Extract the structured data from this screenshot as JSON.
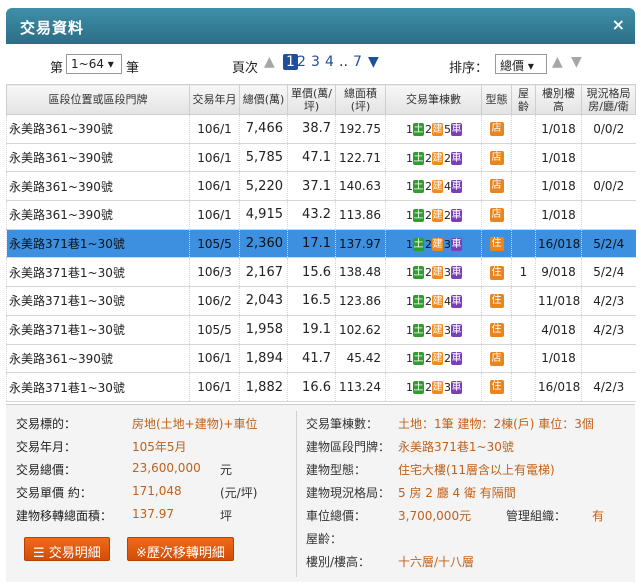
{
  "window": {
    "title": "交易資料",
    "close_icon": "×"
  },
  "toolbar": {
    "select_prefix": "第",
    "range_value": "1~64",
    "select_suffix": "筆",
    "page_label": "頁次",
    "pages": [
      "1",
      "2",
      "3",
      "4",
      "..",
      "7"
    ],
    "sort_label": "排序：",
    "sort_value": "總價"
  },
  "columns": [
    "區段位置或區段門牌",
    "交易年月",
    "總價(萬)",
    "單價(萬/坪)",
    "總面積(坪)",
    "交易筆棟數",
    "型態",
    "屋齡",
    "樓別樓高",
    "現況格局房/廳/衛"
  ],
  "rows": [
    {
      "addr": "永美路361~390號",
      "ym": "106/1",
      "total": "7,466",
      "unit": "38.7",
      "area": "192.75",
      "land": "1",
      "bld": "2",
      "car": "5",
      "type": "店",
      "age": "",
      "floor": "1/018",
      "layout": "0/0/2",
      "hl": false
    },
    {
      "addr": "永美路361~390號",
      "ym": "106/1",
      "total": "5,785",
      "unit": "47.1",
      "area": "122.71",
      "land": "1",
      "bld": "2",
      "car": "2",
      "type": "店",
      "age": "",
      "floor": "1/018",
      "layout": "",
      "hl": false
    },
    {
      "addr": "永美路361~390號",
      "ym": "106/1",
      "total": "5,220",
      "unit": "37.1",
      "area": "140.63",
      "land": "1",
      "bld": "2",
      "car": "4",
      "type": "店",
      "age": "",
      "floor": "1/018",
      "layout": "0/0/2",
      "hl": false
    },
    {
      "addr": "永美路361~390號",
      "ym": "106/1",
      "total": "4,915",
      "unit": "43.2",
      "area": "113.86",
      "land": "1",
      "bld": "2",
      "car": "2",
      "type": "店",
      "age": "",
      "floor": "1/018",
      "layout": "",
      "hl": false
    },
    {
      "addr": "永美路371巷1~30號",
      "ym": "105/5",
      "total": "2,360",
      "unit": "17.1",
      "area": "137.97",
      "land": "1",
      "bld": "2",
      "car": "3",
      "type": "住",
      "age": "",
      "floor": "16/018",
      "layout": "5/2/4",
      "hl": true
    },
    {
      "addr": "永美路371巷1~30號",
      "ym": "106/3",
      "total": "2,167",
      "unit": "15.6",
      "area": "138.48",
      "land": "1",
      "bld": "2",
      "car": "3",
      "type": "住",
      "age": "1",
      "floor": "9/018",
      "layout": "5/2/4",
      "hl": false
    },
    {
      "addr": "永美路371巷1~30號",
      "ym": "106/2",
      "total": "2,043",
      "unit": "16.5",
      "area": "123.86",
      "land": "1",
      "bld": "2",
      "car": "4",
      "type": "住",
      "age": "",
      "floor": "11/018",
      "layout": "4/2/3",
      "hl": false
    },
    {
      "addr": "永美路371巷1~30號",
      "ym": "105/5",
      "total": "1,958",
      "unit": "19.1",
      "area": "102.62",
      "land": "1",
      "bld": "2",
      "car": "3",
      "type": "住",
      "age": "",
      "floor": "4/018",
      "layout": "4/2/3",
      "hl": false
    },
    {
      "addr": "永美路361~390號",
      "ym": "106/1",
      "total": "1,894",
      "unit": "41.7",
      "area": "45.42",
      "land": "1",
      "bld": "2",
      "car": "2",
      "type": "店",
      "age": "",
      "floor": "1/018",
      "layout": "",
      "hl": false
    },
    {
      "addr": "永美路371巷1~30號",
      "ym": "106/1",
      "total": "1,882",
      "unit": "16.6",
      "area": "113.24",
      "land": "1",
      "bld": "2",
      "car": "3",
      "type": "住",
      "age": "",
      "floor": "16/018",
      "layout": "4/2/3",
      "hl": false
    }
  ],
  "badges": {
    "land": "土",
    "bld": "建",
    "car": "車"
  },
  "details": {
    "left": [
      {
        "label": "交易標的：",
        "value": "房地(土地+建物)+車位",
        "unit": ""
      },
      {
        "label": "交易年月：",
        "value": "105年5月",
        "unit": ""
      },
      {
        "label": "交易總價：",
        "value": "23,600,000",
        "unit": "元"
      },
      {
        "label": "交易單價 約：",
        "value": "171,048",
        "unit": "(元/坪)"
      },
      {
        "label": "建物移轉總面積：",
        "value": "137.97",
        "unit": "坪"
      }
    ],
    "right": [
      {
        "label": "交易筆棟數：",
        "value": "土地：1筆 建物：2棟(戶) 車位：3個"
      },
      {
        "label": "建物區段門牌：",
        "value": "永美路371巷1~30號"
      },
      {
        "label": "建物型態：",
        "value": "住宅大樓(11層含以上有電梯)"
      },
      {
        "label": "建物現況格局：",
        "value": "5 房 2 廳 4 衛 有隔間"
      },
      {
        "label": "車位總價：",
        "value": "3,700,000元"
      },
      {
        "label": "屋齡：",
        "value": ""
      },
      {
        "label": "樓別/樓高：",
        "value": "十六層/十八層"
      }
    ],
    "manage_label": "管理組織：",
    "manage_value": "有"
  },
  "buttons": {
    "detail": "交易明細",
    "history": "※歷次移轉明細"
  },
  "colors": {
    "header": "#2c6d86",
    "highlight": "#3d8fe0",
    "accent": "#c0611a",
    "button": "#e05a10"
  }
}
